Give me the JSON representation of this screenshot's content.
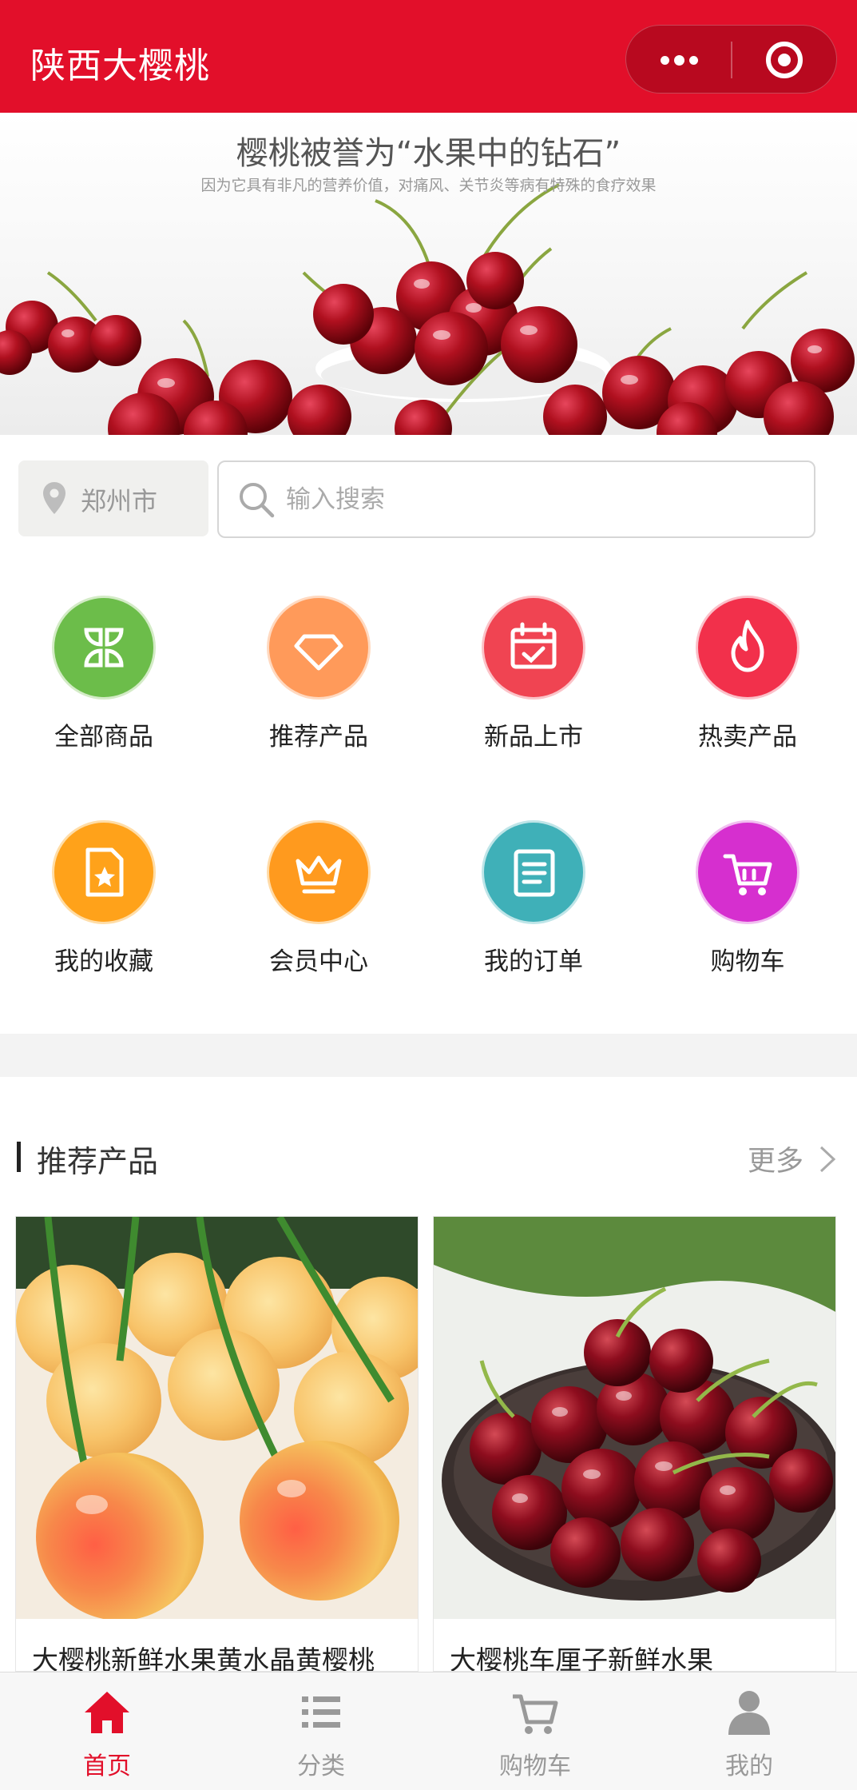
{
  "header": {
    "title": "陕西大樱桃",
    "brand_color": "#e20f2a"
  },
  "capsule": {
    "more_icon": "more-dots-icon",
    "close_icon": "target-close-icon"
  },
  "banner": {
    "headline": "樱桃被誉为“水果中的钻石”",
    "subline": "因为它具有非凡的营养价值，对痛风、关节炎等病有特殊的食疗效果"
  },
  "location": {
    "city": "郑州市",
    "icon": "location-pin-icon"
  },
  "search": {
    "placeholder": "输入搜索",
    "value": "",
    "icon": "search-icon"
  },
  "categories": [
    {
      "label": "全部商品",
      "icon": "leaf-grid-icon",
      "color": "#6cbd4a"
    },
    {
      "label": "推荐产品",
      "icon": "diamond-icon",
      "color": "#ff9a5a"
    },
    {
      "label": "新品上市",
      "icon": "calendar-check-icon",
      "color": "#f04452"
    },
    {
      "label": "热卖产品",
      "icon": "flame-icon",
      "color": "#f2304b"
    },
    {
      "label": "我的收藏",
      "icon": "star-document-icon",
      "color": "#ffa21a"
    },
    {
      "label": "会员中心",
      "icon": "crown-icon",
      "color": "#ff9a1e"
    },
    {
      "label": "我的订单",
      "icon": "order-list-icon",
      "color": "#3fb0b8"
    },
    {
      "label": "购物车",
      "icon": "cart-icon",
      "color": "#d62fcf"
    }
  ],
  "recommend": {
    "title": "推荐产品",
    "more": "更多",
    "products": [
      {
        "name": "大樱桃新鲜水果黄水晶黄樱桃"
      },
      {
        "name": "大樱桃车厘子新鲜水果"
      }
    ]
  },
  "tabbar": [
    {
      "label": "首页",
      "icon": "home-icon",
      "active": true
    },
    {
      "label": "分类",
      "icon": "category-list-icon",
      "active": false
    },
    {
      "label": "购物车",
      "icon": "cart-icon",
      "active": false
    },
    {
      "label": "我的",
      "icon": "user-icon",
      "active": false
    }
  ],
  "colors": {
    "active": "#e20f2a",
    "inactive": "#999999"
  }
}
